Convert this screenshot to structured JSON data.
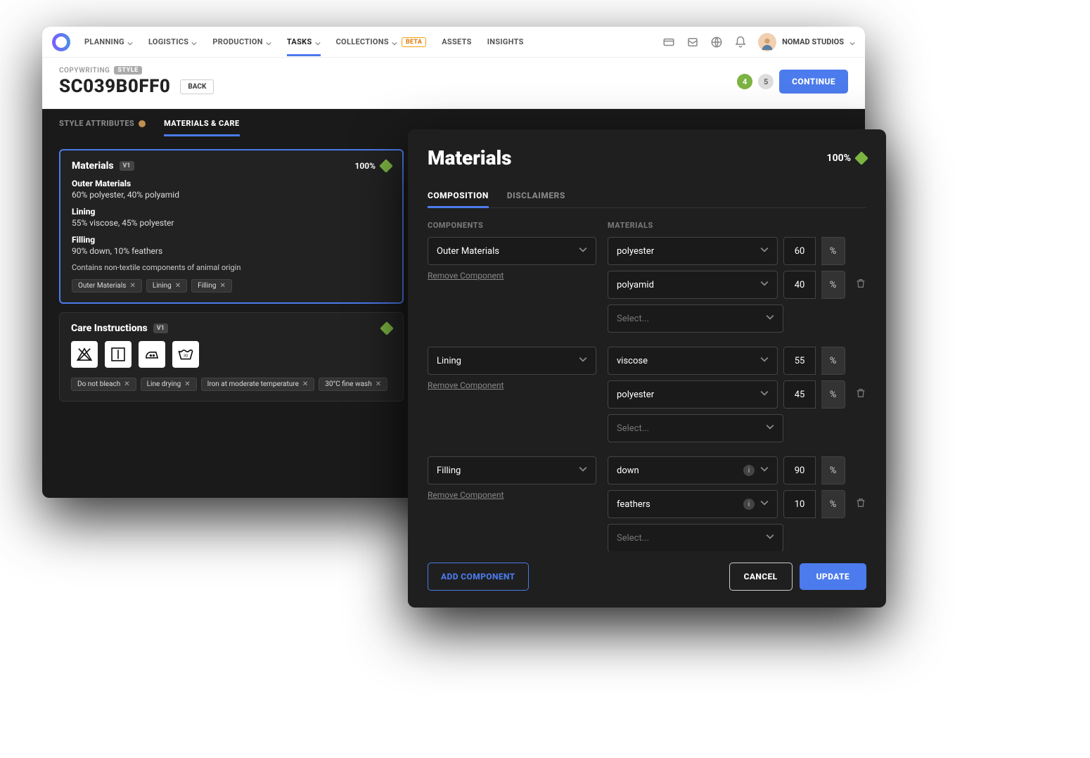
{
  "nav": {
    "items": [
      {
        "label": "PLANNING"
      },
      {
        "label": "LOGISTICS"
      },
      {
        "label": "PRODUCTION"
      },
      {
        "label": "TASKS",
        "active": true
      },
      {
        "label": "COLLECTIONS",
        "beta": true
      },
      {
        "label": "ASSETS"
      },
      {
        "label": "INSIGHTS"
      }
    ],
    "beta_label": "BETA",
    "profile_name": "NOMAD STUDIOS"
  },
  "title": {
    "breadcrumb": "COPYWRITING",
    "style_badge": "STYLE",
    "page_title": "SC039B0FF0",
    "back_label": "BACK",
    "count_green": "4",
    "count_grey": "5",
    "continue_label": "CONTINUE"
  },
  "subtabs": {
    "style_attr": "STYLE ATTRIBUTES",
    "materials": "MATERIALS & CARE"
  },
  "materials_card": {
    "title": "Materials",
    "version": "V1",
    "percent": "100%",
    "sections": [
      {
        "title": "Outer Materials",
        "body": "60% polyester, 40% polyamid"
      },
      {
        "title": "Lining",
        "body": "55% viscose, 45% polyester"
      },
      {
        "title": "Filling",
        "body": "90% down, 10% feathers"
      }
    ],
    "disclaimer": "Contains non-textile components of animal origin",
    "chips": [
      "Outer Materials",
      "Lining",
      "Filling"
    ]
  },
  "care_card": {
    "title": "Care Instructions",
    "version": "V1",
    "chips": [
      "Do not bleach",
      "Line drying",
      "Iron at moderate temperature",
      "30°C fine wash"
    ]
  },
  "panel": {
    "title": "Materials",
    "percent": "100%",
    "tab_composition": "COMPOSITION",
    "tab_disclaimers": "DISCLAIMERS",
    "col_components": "COMPONENTS",
    "col_materials": "MATERIALS",
    "remove_label": "Remove Component",
    "select_placeholder": "Select...",
    "percent_symbol": "%",
    "components": [
      {
        "name": "Outer Materials",
        "materials": [
          {
            "name": "polyester",
            "pct": "60"
          },
          {
            "name": "polyamid",
            "pct": "40"
          }
        ]
      },
      {
        "name": "Lining",
        "materials": [
          {
            "name": "viscose",
            "pct": "55"
          },
          {
            "name": "polyester",
            "pct": "45"
          }
        ]
      },
      {
        "name": "Filling",
        "materials": [
          {
            "name": "down",
            "pct": "90",
            "info": true
          },
          {
            "name": "feathers",
            "pct": "10",
            "info": true
          }
        ]
      }
    ],
    "add_component": "ADD COMPONENT",
    "cancel": "CANCEL",
    "update": "UPDATE"
  }
}
